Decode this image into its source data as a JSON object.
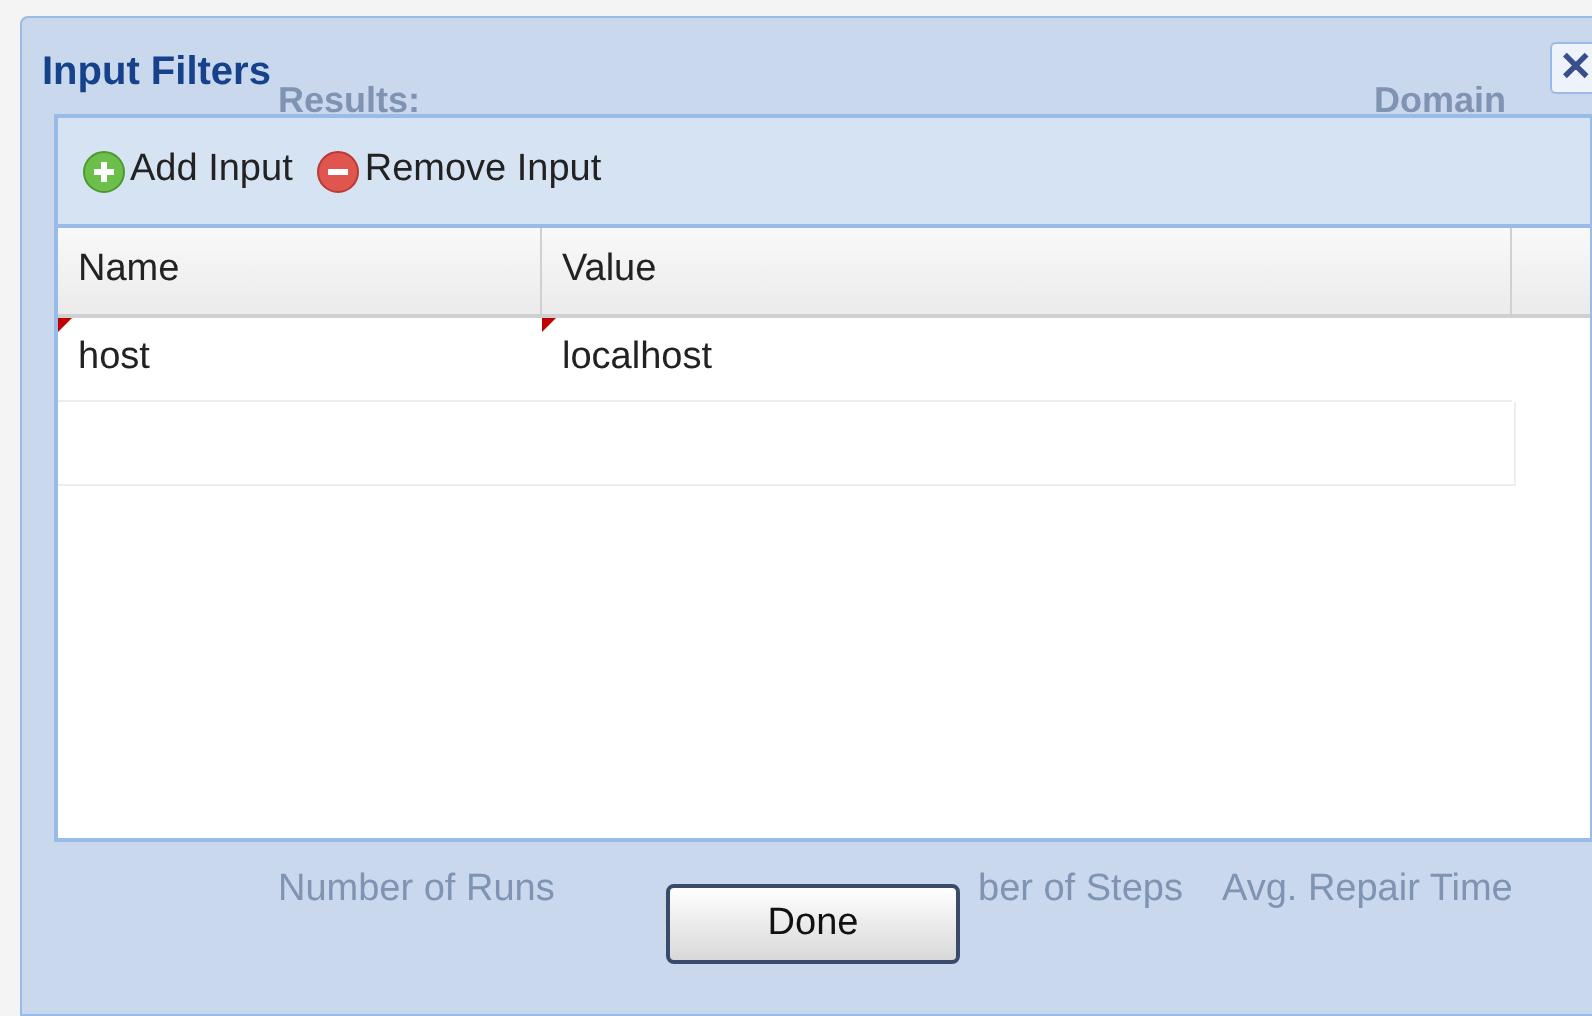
{
  "window": {
    "title": "Input Filters",
    "close": "✕"
  },
  "background_texts": {
    "header": [
      "Results:",
      "Domain"
    ],
    "footer": [
      "Number of Runs",
      "ber of Steps",
      "Avg. Repair Time"
    ]
  },
  "toolbar": [
    {
      "kind": "add",
      "label": "Add Input"
    },
    {
      "kind": "remove",
      "label": "Remove Input"
    }
  ],
  "table": {
    "columns": [
      "Name",
      "Value"
    ],
    "rows": [
      {
        "cells": [
          {
            "text": "host",
            "dirty": true
          },
          {
            "text": "localhost",
            "dirty": true
          }
        ]
      }
    ]
  },
  "buttons": [
    "Done"
  ]
}
